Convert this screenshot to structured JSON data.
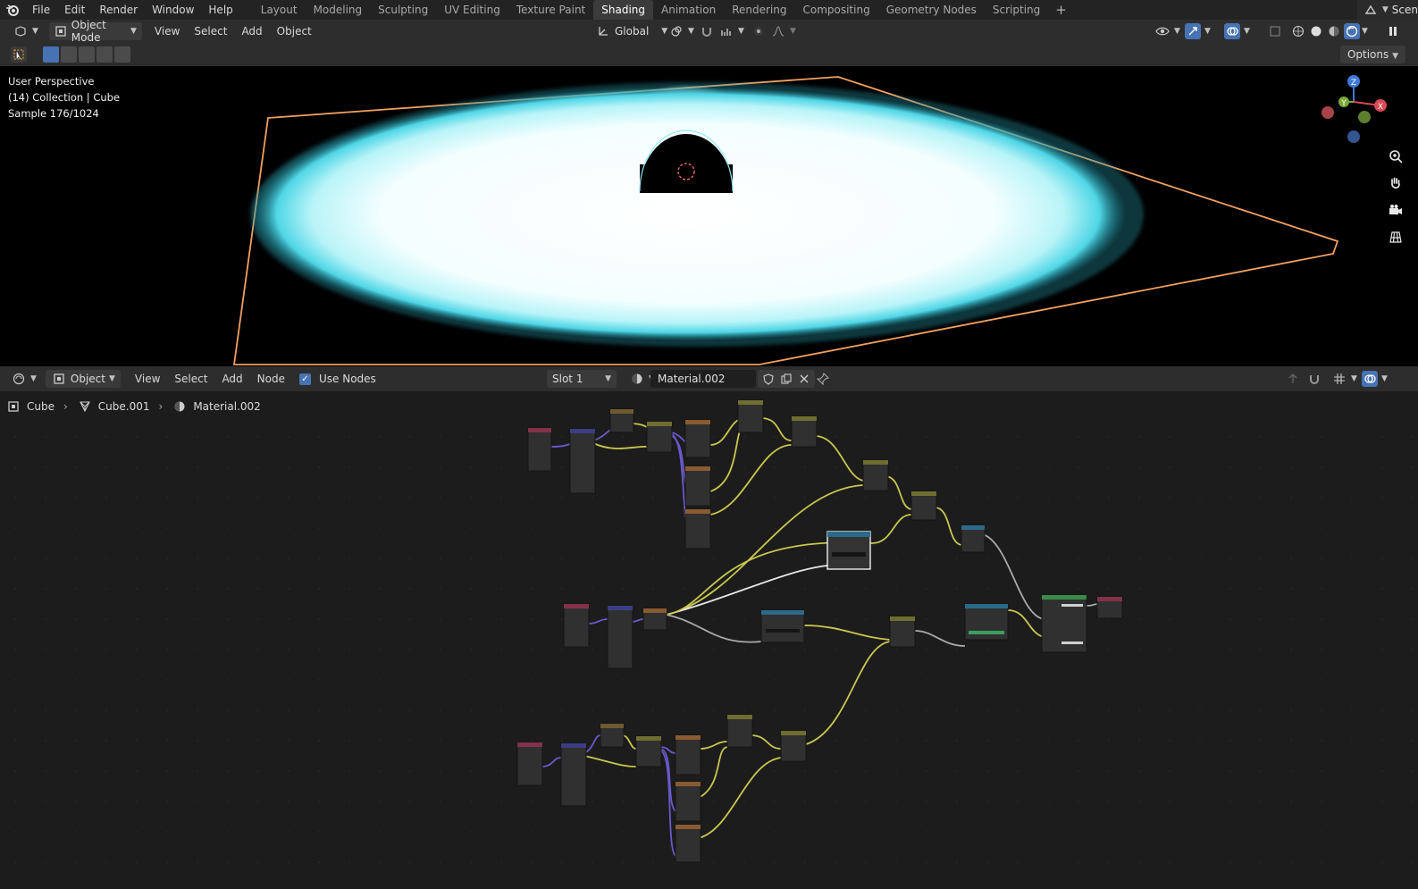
{
  "menubar": {
    "items": [
      "File",
      "Edit",
      "Render",
      "Window",
      "Help"
    ],
    "workspaces": [
      "Layout",
      "Modeling",
      "Sculpting",
      "UV Editing",
      "Texture Paint",
      "Shading",
      "Animation",
      "Rendering",
      "Compositing",
      "Geometry Nodes",
      "Scripting"
    ],
    "active_workspace": "Shading",
    "scene_label": "Scen"
  },
  "viewport_header": {
    "mode": "Object Mode",
    "menus": [
      "View",
      "Select",
      "Add",
      "Object"
    ],
    "orientation": "Global",
    "options_label": "Options"
  },
  "viewport": {
    "perspective": "User Perspective",
    "collection": "(14) Collection | Cube",
    "sample": "Sample 176/1024",
    "gizmo_axes": [
      "Z",
      "Y",
      "X"
    ],
    "colors": {
      "x": "#d94a55",
      "y": "#7da838",
      "z": "#3f78d8",
      "selection": "#f0a060",
      "glow": "#66e8f0"
    }
  },
  "node_header": {
    "object_type": "Object",
    "menus": [
      "View",
      "Select",
      "Add",
      "Node"
    ],
    "use_nodes_label": "Use Nodes",
    "use_nodes_checked": true,
    "slot": "Slot 1",
    "material": "Material.002"
  },
  "breadcrumb": {
    "object": "Cube",
    "mesh": "Cube.001",
    "material": "Material.002"
  }
}
